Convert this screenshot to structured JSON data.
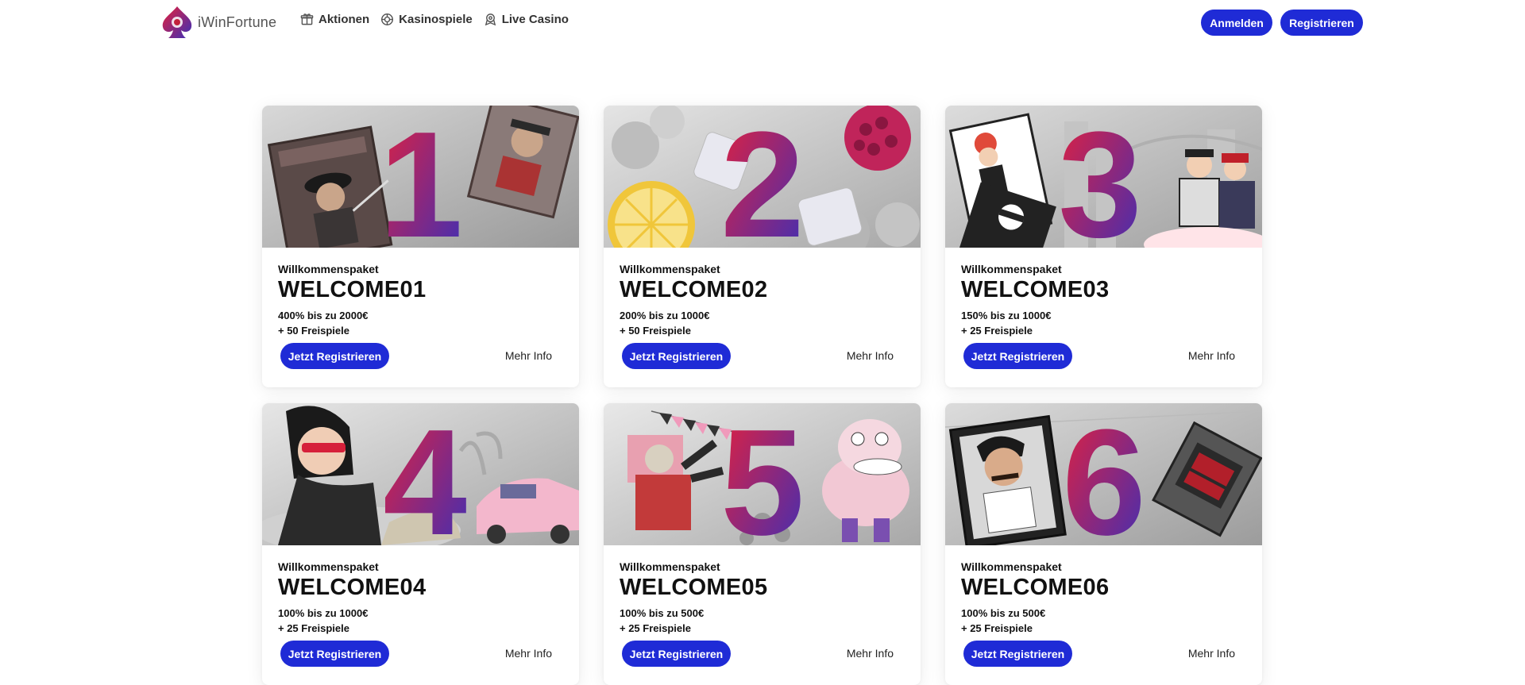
{
  "brand": {
    "name": "iWinFortune"
  },
  "nav": {
    "items": [
      {
        "label": "Aktionen",
        "icon": "gift-icon"
      },
      {
        "label": "Kasinospiele",
        "icon": "casino-chip-icon"
      },
      {
        "label": "Live Casino",
        "icon": "live-dealer-icon"
      }
    ]
  },
  "auth": {
    "login_label": "Anmelden",
    "register_label": "Registrieren"
  },
  "colors": {
    "accent": "#1f2bd6",
    "number_gradient_start": "#e8203a",
    "number_gradient_end": "#3a2fb8"
  },
  "cards": [
    {
      "number": "1",
      "theme": "western-wanted-posters",
      "package_label": "Willkommenspaket",
      "code": "WELCOME01",
      "offer_line1": "400% bis zu 2000€",
      "offer_line2": "+ 50 Freispiele",
      "cta_label": "Jetzt Registrieren",
      "more_label": "Mehr Info"
    },
    {
      "number": "2",
      "theme": "fruits-and-ice",
      "package_label": "Willkommenspaket",
      "code": "WELCOME02",
      "offer_line1": "200% bis zu 1000€",
      "offer_line2": "+ 50 Freispiele",
      "cta_label": "Jetzt Registrieren",
      "more_label": "Mehr Info"
    },
    {
      "number": "3",
      "theme": "noir-city-comic",
      "package_label": "Willkommenspaket",
      "code": "WELCOME03",
      "offer_line1": "150% bis zu 1000€",
      "offer_line2": "+ 25 Freispiele",
      "cta_label": "Jetzt Registrieren",
      "more_label": "Mehr Info"
    },
    {
      "number": "4",
      "theme": "retro-sports-car",
      "package_label": "Willkommenspaket",
      "code": "WELCOME04",
      "offer_line1": "100% bis zu 1000€",
      "offer_line2": "+ 25 Freispiele",
      "cta_label": "Jetzt Registrieren",
      "more_label": "Mehr Info"
    },
    {
      "number": "5",
      "theme": "fiesta-pinata",
      "package_label": "Willkommenspaket",
      "code": "WELCOME05",
      "offer_line1": "100% bis zu 500€",
      "offer_line2": "+ 25 Freispiele",
      "cta_label": "Jetzt Registrieren",
      "more_label": "Mehr Info"
    },
    {
      "number": "6",
      "theme": "narcos-briefcase",
      "package_label": "Willkommenspaket",
      "code": "WELCOME06",
      "offer_line1": "100% bis zu 500€",
      "offer_line2": "+ 25 Freispiele",
      "cta_label": "Jetzt Registrieren",
      "more_label": "Mehr Info"
    }
  ]
}
